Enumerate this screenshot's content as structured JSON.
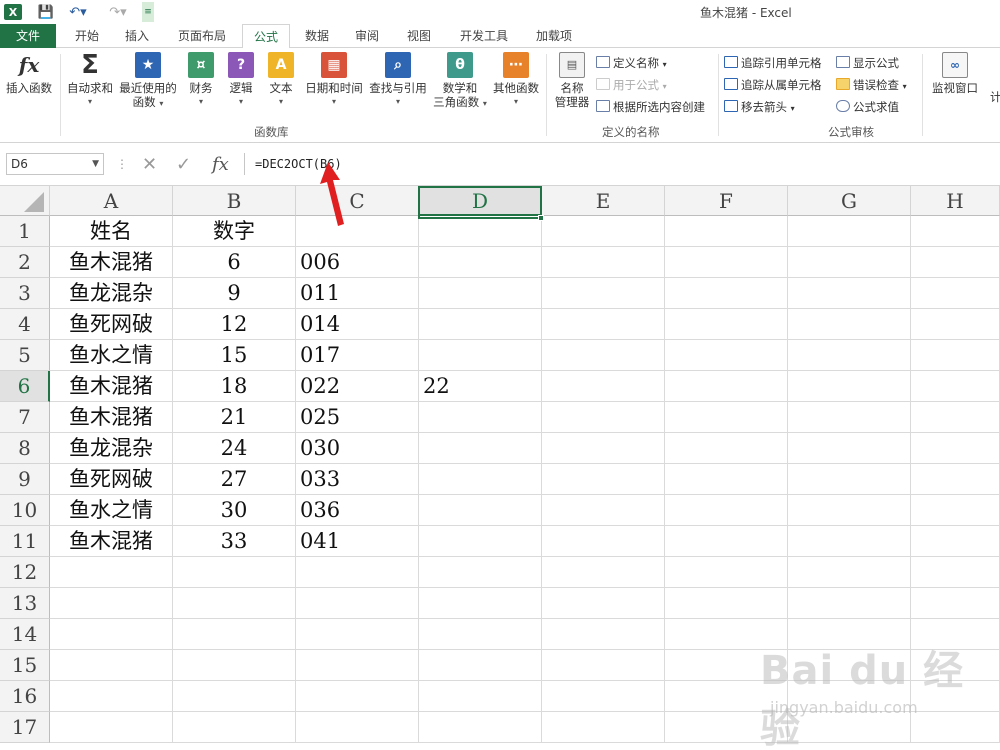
{
  "window_title": "鱼木混猪 - Excel",
  "tabs": [
    "文件",
    "开始",
    "插入",
    "页面布局",
    "公式",
    "数据",
    "审阅",
    "视图",
    "开发工具",
    "加载项"
  ],
  "ribbon": {
    "function_library": {
      "insert_function": "插入函数",
      "autosum": "自动求和",
      "recent_1": "最近使用的",
      "recent_2": "函数",
      "financial": "财务",
      "logical": "逻辑",
      "text": "文本",
      "datetime": "日期和时间",
      "lookup": "查找与引用",
      "math_1": "数学和",
      "math_2": "三角函数",
      "more": "其他函数",
      "group_label": "函数库"
    },
    "defined_names": {
      "name_manager_1": "名称",
      "name_manager_2": "管理器",
      "define_name": "定义名称",
      "use_in_formula": "用于公式",
      "create_from_selection": "根据所选内容创建",
      "group_label": "定义的名称"
    },
    "formula_auditing": {
      "trace_precedents": "追踪引用单元格",
      "trace_dependents": "追踪从属单元格",
      "remove_arrows": "移去箭头",
      "show_formulas": "显示公式",
      "error_checking": "错误检查",
      "evaluate_formula": "公式求值",
      "group_label": "公式审核"
    },
    "watch_window": "监视窗口",
    "calc_partial": "计"
  },
  "formula_bar": {
    "name_box": "D6",
    "cancel_glyph": "✕",
    "enter_glyph": "✓",
    "fx_glyph": "fx",
    "formula": "=DEC2OCT(B6)"
  },
  "columns": [
    "A",
    "B",
    "C",
    "D",
    "E",
    "F",
    "G",
    "H"
  ],
  "rows": [
    "1",
    "2",
    "3",
    "4",
    "5",
    "6",
    "7",
    "8",
    "9",
    "10",
    "11",
    "12",
    "13",
    "14",
    "15",
    "16",
    "17"
  ],
  "cells": {
    "A": [
      "姓名",
      "鱼木混猪",
      "鱼龙混杂",
      "鱼死网破",
      "鱼水之情",
      "鱼木混猪",
      "鱼木混猪",
      "鱼龙混杂",
      "鱼死网破",
      "鱼水之情",
      "鱼木混猪"
    ],
    "B": [
      "数字",
      "6",
      "9",
      "12",
      "15",
      "18",
      "21",
      "24",
      "27",
      "30",
      "33"
    ],
    "C": [
      "",
      "006",
      "011",
      "014",
      "017",
      "022",
      "025",
      "030",
      "033",
      "036",
      "041"
    ],
    "D6": "22"
  },
  "watermark": {
    "logo": "Bai du 经验",
    "url": "jingyan.baidu.com"
  },
  "colors": {
    "accent": "#217346",
    "arrow": "#e02020"
  }
}
